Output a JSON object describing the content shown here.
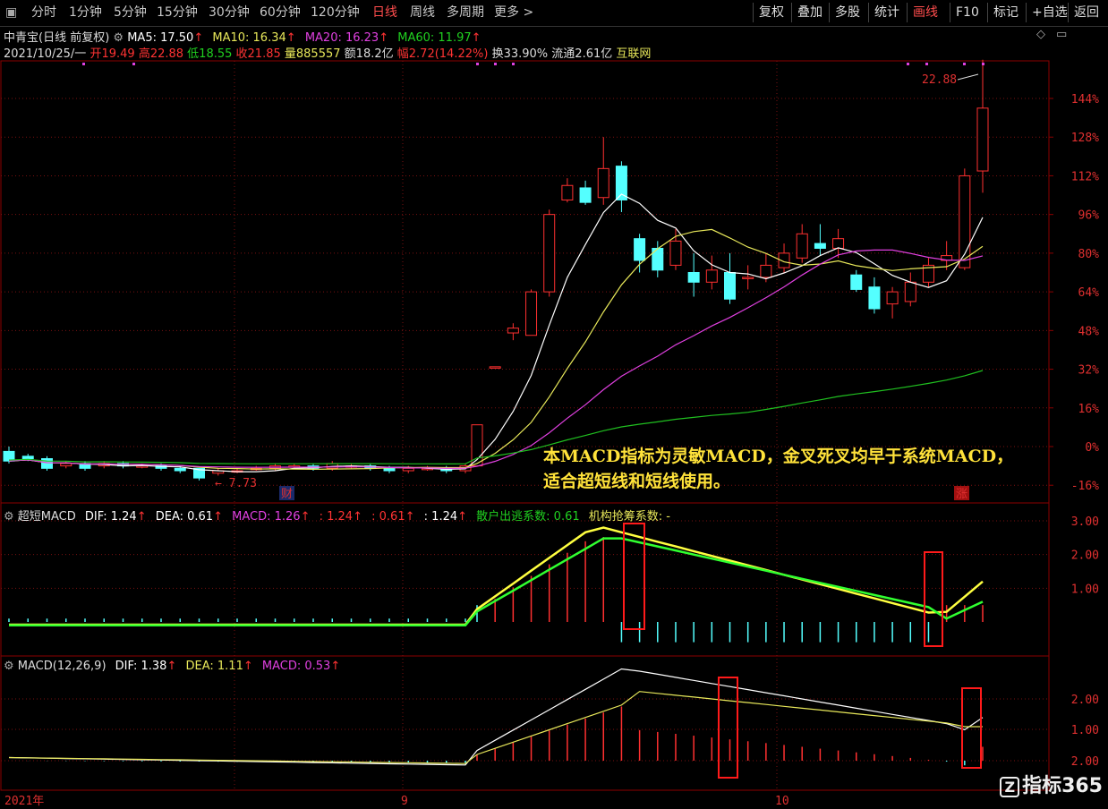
{
  "toolbar": {
    "periods": [
      "分时",
      "1分钟",
      "5分钟",
      "15分钟",
      "30分钟",
      "60分钟",
      "120分钟",
      "日线",
      "周线",
      "多周期",
      "更多 >"
    ],
    "selected_period": "日线",
    "right_buttons": [
      "复权",
      "叠加",
      "多股",
      "统计",
      "画线",
      "F10",
      "标记",
      "+自选",
      "返回"
    ],
    "selected_right": "画线"
  },
  "header": {
    "stock": "中青宝(日线 前复权)",
    "ma5": "MA5: 17.50",
    "ma10": "MA10: 16.34",
    "ma20": "MA20: 16.23",
    "ma60": "MA60: 11.97",
    "date": "2021/10/25/一",
    "open": "开19.49",
    "high": "高22.88",
    "low": "低18.55",
    "close": "收21.85",
    "volume": "量885557",
    "amount": "额18.2亿",
    "change": "幅2.72(14.22%)",
    "turnover": "换33.90%",
    "float": "流通2.61亿",
    "sector": "互联网"
  },
  "main_chart": {
    "y_axis": [
      "144%",
      "128%",
      "112%",
      "96%",
      "80%",
      "64%",
      "48%",
      "32%",
      "16%",
      "0%",
      "-16%"
    ],
    "high_mark": "22.88",
    "low_mark": "7.73",
    "badge_cai": "财",
    "badge_zhang": "涨",
    "note_lines": [
      "本MACD指标为灵敏MACD，金叉死叉均早于系统MACD，",
      "适合超短线和短线使用。"
    ]
  },
  "panel1": {
    "title": "超短MACD",
    "dif": "DIF: 1.24",
    "dea": "DEA: 0.61",
    "macd": "MACD: 1.26",
    "v1": ": 1.24",
    "v2": ": 0.61",
    "v3": ": 1.24",
    "retail": "散户出逃系数: 0.61",
    "inst": "机构抢筹系数: -",
    "y_axis": [
      "3.00",
      "2.00",
      "1.00"
    ]
  },
  "panel2": {
    "title": "MACD(12,26,9)",
    "dif": "DIF: 1.38",
    "dea": "DEA: 1.11",
    "macd": "MACD: 0.53",
    "y_axis": [
      "2.00",
      "1.00",
      "2.00"
    ]
  },
  "x_axis": [
    "2021年",
    "9",
    "10"
  ],
  "watermark": "指标365",
  "colors": {
    "up": "#ff3030",
    "down": "#54ffff",
    "ma5": "#ffffff",
    "ma10": "#e8e85a",
    "ma20": "#e040e0",
    "ma60": "#20c020",
    "grid": "#8b0000"
  },
  "chart_data": {
    "type": "candlestick",
    "y_unit": "percent",
    "candles_pct": [
      [
        -2,
        -6,
        -7,
        0
      ],
      [
        -4,
        -5,
        -6,
        -3
      ],
      [
        -5,
        -9,
        -10,
        -4
      ],
      [
        -8,
        -7,
        -9,
        -6
      ],
      [
        -7,
        -9,
        -10,
        -6
      ],
      [
        -8,
        -7,
        -9,
        -6
      ],
      [
        -7,
        -8,
        -9,
        -6
      ],
      [
        -8,
        -8,
        -9,
        -7
      ],
      [
        -8,
        -9,
        -10,
        -7
      ],
      [
        -9,
        -10,
        -11,
        -8
      ],
      [
        -9,
        -13,
        -14,
        -9
      ],
      [
        -11,
        -10,
        -12,
        -9
      ],
      [
        -10,
        -10,
        -11,
        -9
      ],
      [
        -9,
        -9,
        -10,
        -8
      ],
      [
        -9,
        -8,
        -10,
        -7
      ],
      [
        -8,
        -8,
        -9,
        -7
      ],
      [
        -8,
        -9,
        -10,
        -7
      ],
      [
        -9,
        -7,
        -10,
        -6
      ],
      [
        -8,
        -8,
        -9,
        -7
      ],
      [
        -8,
        -9,
        -10,
        -7
      ],
      [
        -9,
        -10,
        -11,
        -8
      ],
      [
        -10,
        -9,
        -11,
        -8
      ],
      [
        -9,
        -9,
        -10,
        -8
      ],
      [
        -9,
        -10,
        -11,
        -8
      ],
      [
        -10,
        -8,
        -11,
        -7
      ],
      [
        -8,
        9,
        -8,
        9
      ],
      [
        33,
        33,
        33,
        33
      ],
      [
        47,
        49,
        44,
        51
      ],
      [
        46,
        64,
        46,
        65
      ],
      [
        64,
        96,
        62,
        98
      ],
      [
        102,
        108,
        101,
        111
      ],
      [
        107,
        101,
        100,
        110
      ],
      [
        103,
        115,
        100,
        128
      ],
      [
        116,
        102,
        97,
        118
      ],
      [
        86,
        77,
        72,
        88
      ],
      [
        82,
        73,
        70,
        85
      ],
      [
        75,
        85,
        73,
        90
      ],
      [
        72,
        68,
        62,
        80
      ],
      [
        68,
        73,
        65,
        79
      ],
      [
        72,
        61,
        59,
        80
      ],
      [
        70,
        70,
        65,
        75
      ],
      [
        70,
        75,
        68,
        80
      ],
      [
        74,
        80,
        72,
        84
      ],
      [
        78,
        88,
        76,
        92
      ],
      [
        84,
        82,
        79,
        92
      ],
      [
        82,
        86,
        78,
        90
      ],
      [
        71,
        65,
        64,
        73
      ],
      [
        66,
        57,
        55,
        70
      ],
      [
        59,
        64,
        53,
        66
      ],
      [
        60,
        68,
        58,
        72
      ],
      [
        68,
        75,
        66,
        78
      ],
      [
        77,
        79,
        73,
        85
      ],
      [
        74,
        112,
        73,
        115
      ],
      [
        114,
        140,
        105,
        160
      ]
    ]
  }
}
